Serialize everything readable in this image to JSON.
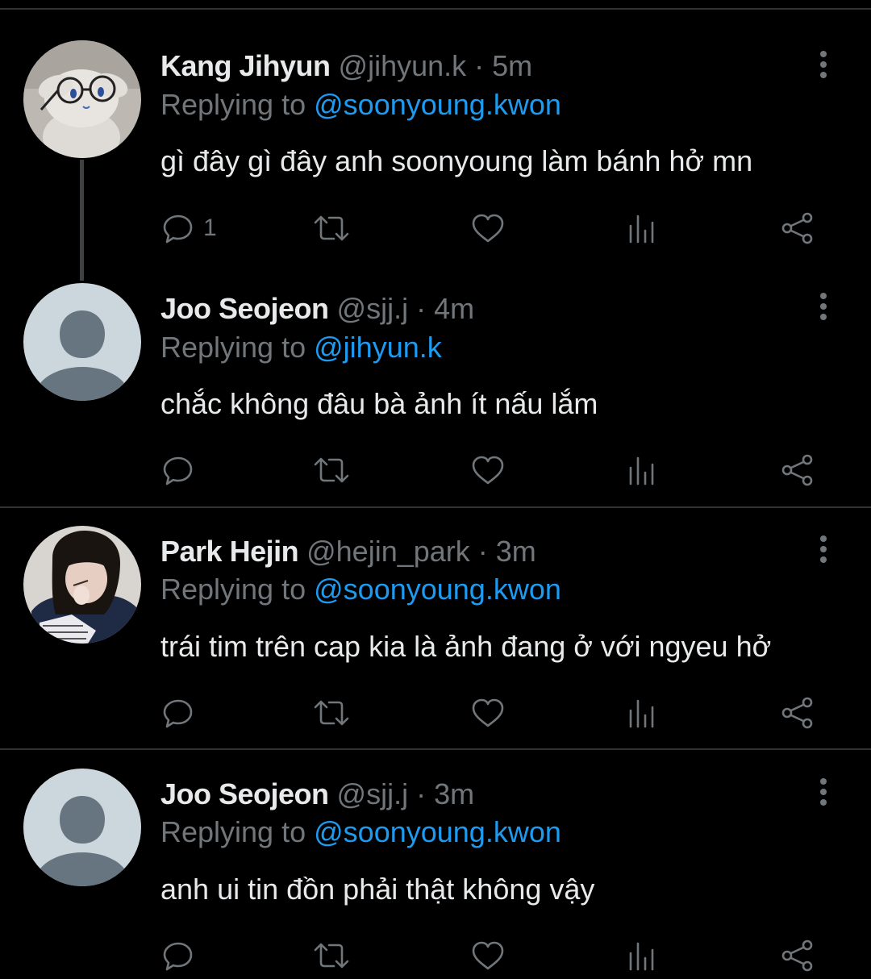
{
  "tweets": [
    {
      "name": "Kang Jihyun",
      "handle": "@jihyun.k",
      "time": "· 5m",
      "replying_prefix": "Replying to",
      "replying_to": "@soonyoung.kwon",
      "text": "gì đây gì đây anh soonyoung làm bánh hở mn",
      "reply_count": "1",
      "avatar": "plush-bunny-photo"
    },
    {
      "name": "Joo Seojeon",
      "handle": "@sjj.j",
      "time": "· 4m",
      "replying_prefix": "Replying to",
      "replying_to": "@jihyun.k",
      "text": "chắc không đâu bà ảnh ít nấu lắm",
      "reply_count": "",
      "avatar": "default-silhouette"
    },
    {
      "name": "Park Hejin",
      "handle": "@hejin_park",
      "time": "· 3m",
      "replying_prefix": "Replying to",
      "replying_to": "@soonyoung.kwon",
      "text": "trái tim trên cap kia là ảnh đang ở với ngyeu hở",
      "reply_count": "",
      "avatar": "girl-photo"
    },
    {
      "name": "Joo Seojeon",
      "handle": "@sjj.j",
      "time": "· 3m",
      "replying_prefix": "Replying to",
      "replying_to": "@soonyoung.kwon",
      "text": "anh ui tin đồn phải thật không vậy",
      "reply_count": "",
      "avatar": "default-silhouette"
    }
  ],
  "icons": [
    "reply-icon",
    "retweet-icon",
    "like-icon",
    "views-icon",
    "share-icon",
    "more-icon"
  ],
  "colors": {
    "background": "#000000",
    "text": "#e7e9ea",
    "muted": "#71767b",
    "link": "#1d9bf0",
    "divider": "#2f3336"
  }
}
